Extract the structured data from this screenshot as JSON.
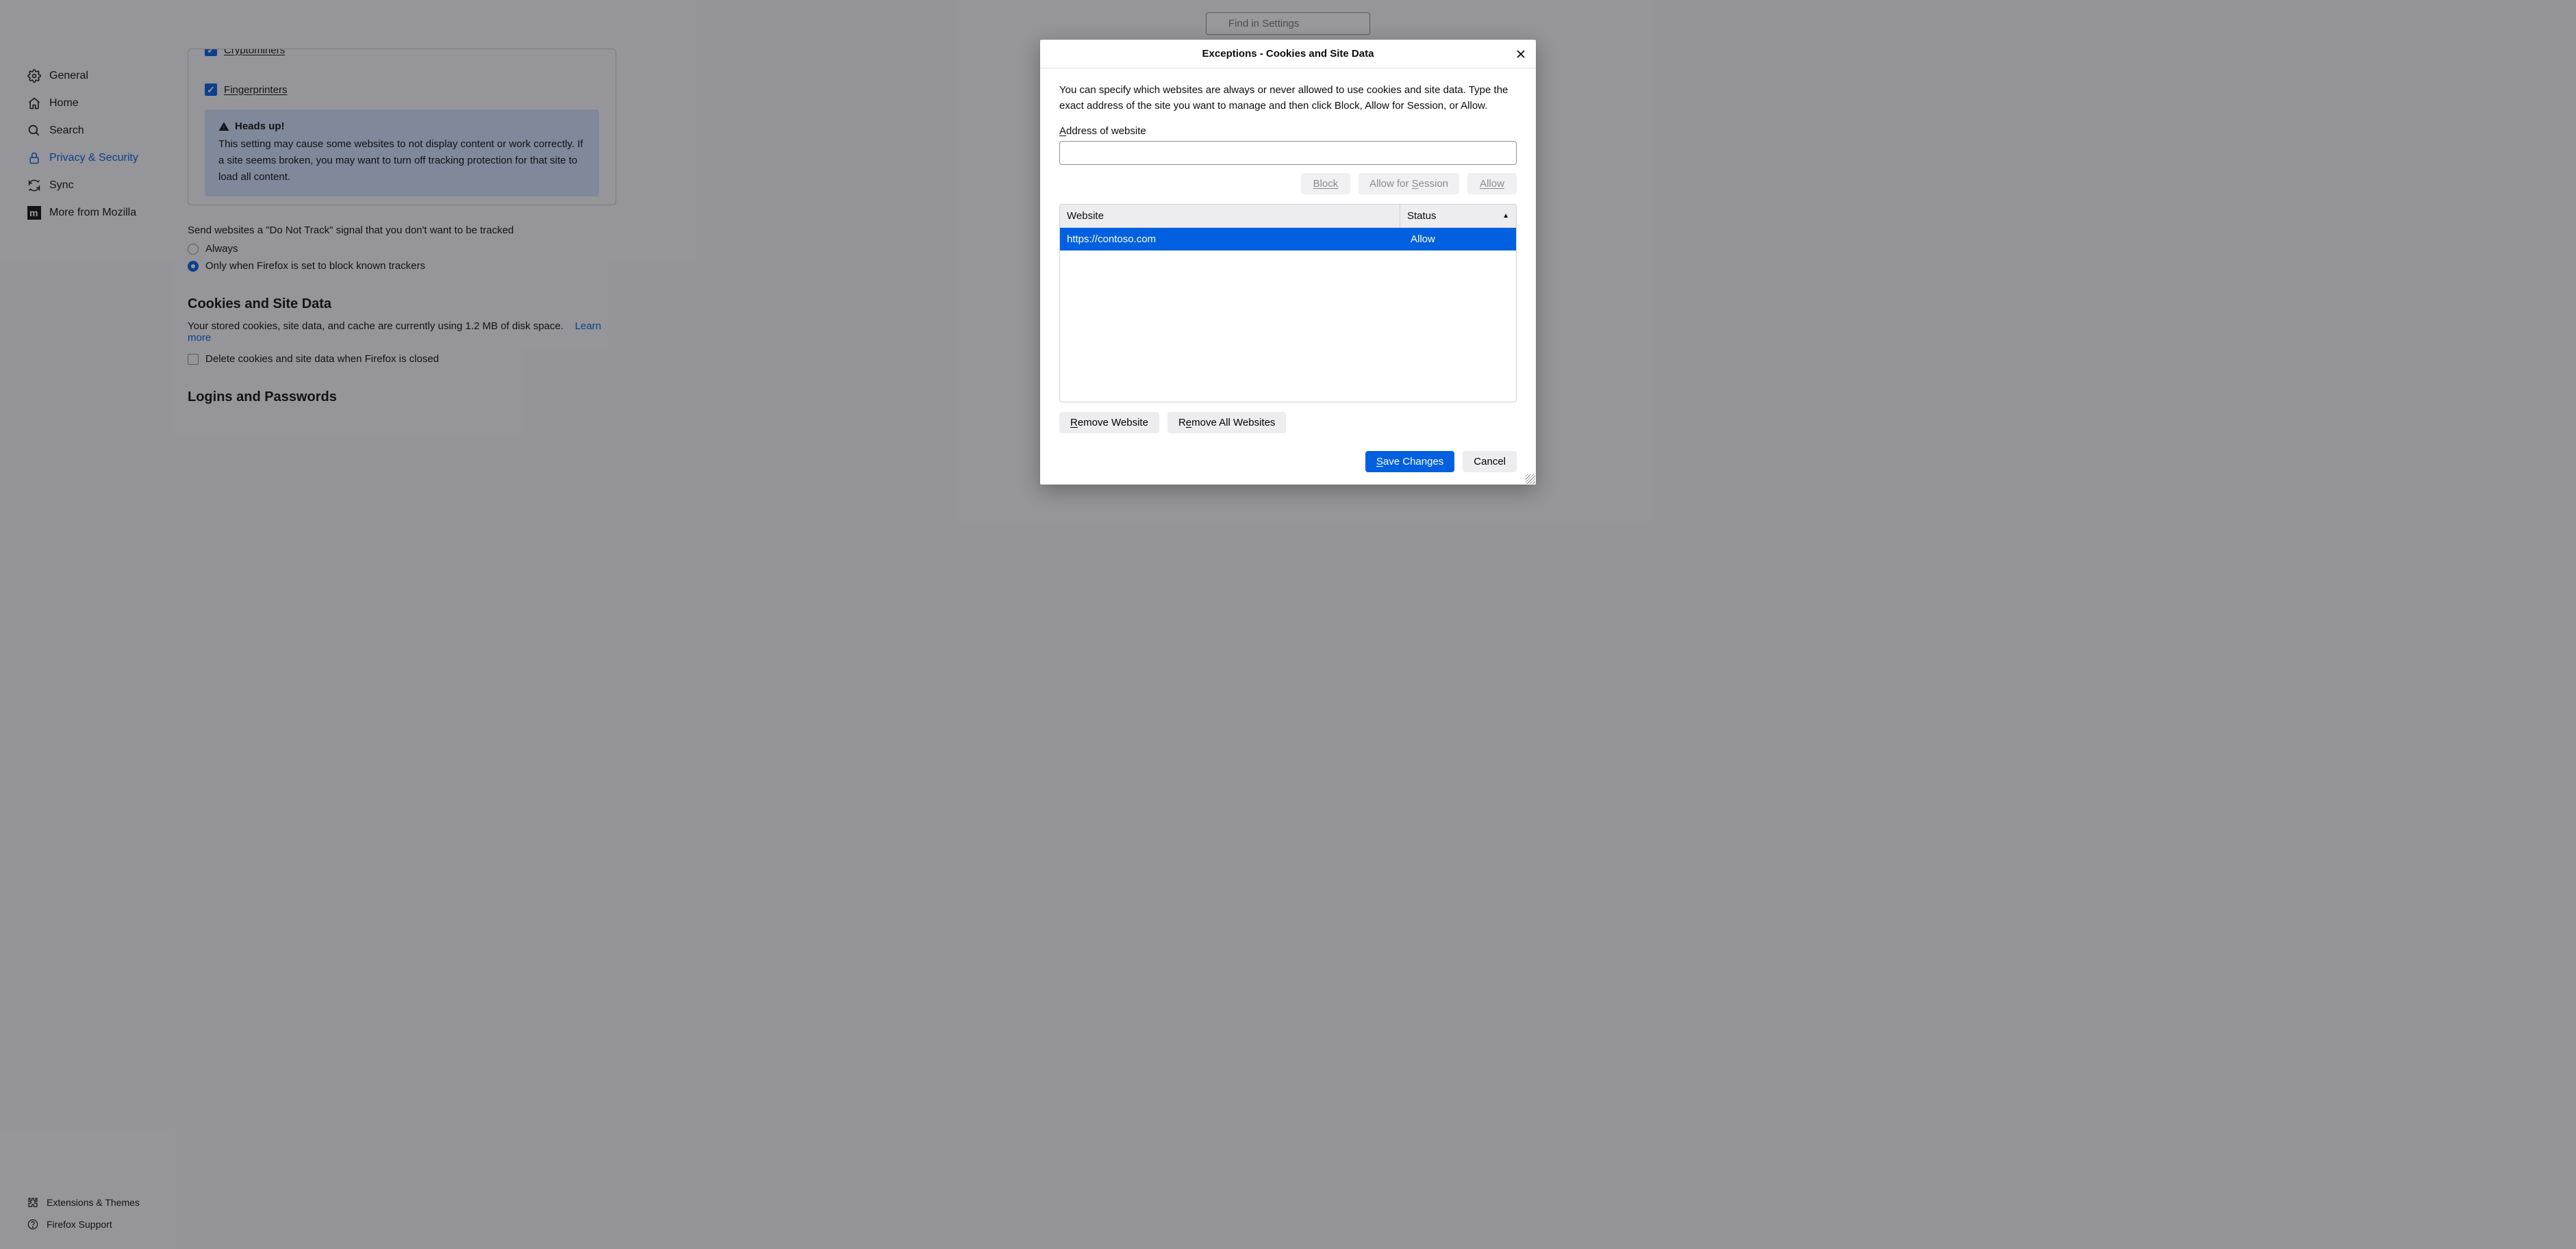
{
  "search": {
    "placeholder": "Find in Settings"
  },
  "sidebar": {
    "items": [
      {
        "label": "General"
      },
      {
        "label": "Home"
      },
      {
        "label": "Search"
      },
      {
        "label": "Privacy & Security"
      },
      {
        "label": "Sync"
      },
      {
        "label": "More from Mozilla"
      }
    ],
    "footer": [
      {
        "label": "Extensions & Themes"
      },
      {
        "label": "Firefox Support"
      }
    ]
  },
  "bg": {
    "tracker1": "Cryptominers",
    "tracker2": "Fingerprinters",
    "heads_up": "Heads up!",
    "heads_body": "This setting may cause some websites to not display content or work correctly. If a site seems broken, you may want to turn off tracking protection for that site to load all content.",
    "dnt_intro": "Send websites a \"Do Not Track\" signal that you don't want to be tracked",
    "radio_always": "Always",
    "radio_only": "Only when Firefox is set to block known trackers",
    "cookies_head": "Cookies and Site Data",
    "cookies_text": "Your stored cookies, site data, and cache are currently using 1.2 MB of disk space.",
    "learn_more": "Learn more",
    "delete_close": "Delete cookies and site data when Firefox is closed",
    "logins_head": "Logins and Passwords"
  },
  "dialog": {
    "title": "Exceptions - Cookies and Site Data",
    "desc": "You can specify which websites are always or never allowed to use cookies and site data. Type the exact address of the site you want to manage and then click Block, Allow for Session, or Allow.",
    "address_label_pre": "A",
    "address_label_post": "ddress of website",
    "address_value": "",
    "block": "Block",
    "allow_session_pre": "Allow for ",
    "allow_session_u": "S",
    "allow_session_post": "ession",
    "allow": "Allow",
    "col_website": "Website",
    "col_status": "Status",
    "rows": [
      {
        "site": "https://contoso.com",
        "status": "Allow"
      }
    ],
    "remove_one_u": "R",
    "remove_one_post": "emove Website",
    "remove_all_pre": "R",
    "remove_all_u": "e",
    "remove_all_post": "move All Websites",
    "save_u": "S",
    "save_post": "ave Changes",
    "cancel": "Cancel"
  }
}
